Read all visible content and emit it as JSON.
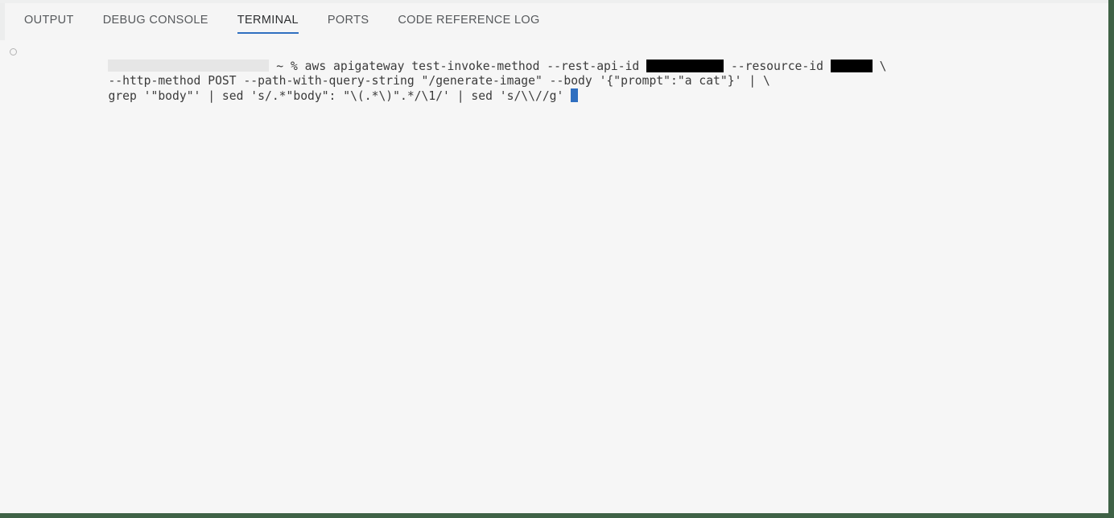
{
  "window": {
    "frame_color": "#3f6246",
    "panel_background": "#f5f5f5"
  },
  "panel": {
    "tabs": [
      {
        "id": "output",
        "label": "OUTPUT",
        "active": false
      },
      {
        "id": "debug-console",
        "label": "DEBUG CONSOLE",
        "active": false
      },
      {
        "id": "terminal",
        "label": "TERMINAL",
        "active": true
      },
      {
        "id": "ports",
        "label": "PORTS",
        "active": false
      },
      {
        "id": "code-reference-log",
        "label": "CODE REFERENCE LOG",
        "active": false
      }
    ],
    "active_tab_underline_color": "#2f6fc0"
  },
  "terminal": {
    "decoration_icon": "circle-icon",
    "prompt": {
      "redacted_host_label": "",
      "path": "~",
      "symbol": "%"
    },
    "line1": {
      "before_redaction": " ~ % aws apigateway test-invoke-method --rest-api-id ",
      "between_redactions": " --resource-id ",
      "after_redaction": " \\"
    },
    "line2": "--http-method POST --path-with-query-string \"/generate-image\" --body '{\"prompt\":\"a cat\"}' | \\",
    "line3": "grep '\"body\"' | sed 's/.*\"body\": \"\\(.*\\)\".*/\\1/' | sed 's/\\\\//g' ",
    "cursor": {
      "name": "block-cursor",
      "color": "#2f6fc0"
    },
    "redactions": {
      "hostname_block_color": "#e6e6e6",
      "rest_api_id_block_color": "#000000",
      "resource_id_block_color": "#000000"
    },
    "text_color": "#3b3b3b",
    "background": "#f6f6f6"
  }
}
